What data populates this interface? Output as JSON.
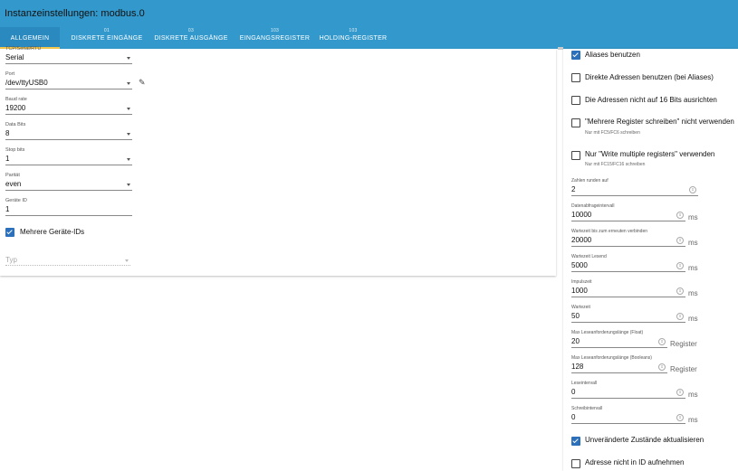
{
  "window": {
    "title": "Instanzeinstellungen: modbus.0"
  },
  "tabs": [
    {
      "label": "ALLGEMEIN",
      "count": ""
    },
    {
      "label": "DISKRETE EINGÄNGE",
      "count": "01"
    },
    {
      "label": "DISKRETE AUSGÄNGE",
      "count": "03"
    },
    {
      "label": "EINGANGSREGISTER",
      "count": "103"
    },
    {
      "label": "HOLDING-REGISTER",
      "count": "103"
    }
  ],
  "left": {
    "type": {
      "label": "TCP/Serial/RTU",
      "value": "Serial"
    },
    "port": {
      "label": "Port",
      "value": "/dev/ttyUSB0"
    },
    "baud": {
      "label": "Baud rate",
      "value": "19200"
    },
    "databits": {
      "label": "Data Bits",
      "value": "8"
    },
    "stopbits": {
      "label": "Stop bits",
      "value": "1"
    },
    "parity": {
      "label": "Parität",
      "value": "even"
    },
    "deviceid": {
      "label": "Geräte ID",
      "value": "1"
    },
    "multi_ids": {
      "label": "Mehrere Geräte-IDs",
      "checked": true
    },
    "typ": {
      "placeholder": "Typ"
    }
  },
  "right": {
    "checkboxes": [
      {
        "label": "Aliases benutzen",
        "checked": true,
        "hint": ""
      },
      {
        "label": "Direkte Adressen benutzen (bei Aliases)",
        "checked": false,
        "hint": ""
      },
      {
        "label": "Die Adressen nicht auf 16 Bits ausrichten",
        "checked": false,
        "hint": ""
      },
      {
        "label": "\"Mehrere Register schreiben\" nicht verwenden",
        "checked": false,
        "hint": "Nur mit FC5/FC6 schreiben"
      },
      {
        "label": "Nur \"Write multiple registers\" verwenden",
        "checked": false,
        "hint": "Nur mit FC15/FC16 schreiben"
      }
    ],
    "fields": [
      {
        "label": "Zahlen runden auf",
        "value": "2",
        "unit": ""
      },
      {
        "label": "Datenabfrageintervall",
        "value": "10000",
        "unit": "ms"
      },
      {
        "label": "Wartezeit bis zum erneuten verbinden",
        "value": "20000",
        "unit": "ms"
      },
      {
        "label": "Wartezeit Lesend",
        "value": "5000",
        "unit": "ms"
      },
      {
        "label": "Impulszeit",
        "value": "1000",
        "unit": "ms"
      },
      {
        "label": "Wartezeit",
        "value": "50",
        "unit": "ms"
      },
      {
        "label": "Max Leseanforderungslänge (Float)",
        "value": "20",
        "unit": "Register"
      },
      {
        "label": "Max Leseanforderungslänge (Booleans)",
        "value": "128",
        "unit": "Register"
      },
      {
        "label": "Leseintervall",
        "value": "0",
        "unit": "ms"
      },
      {
        "label": "Schreibintervall",
        "value": "0",
        "unit": "ms"
      }
    ],
    "bottom_checkboxes": [
      {
        "label": "Unveränderte Zustände aktualisieren",
        "checked": true
      },
      {
        "label": "Adresse nicht in ID aufnehmen",
        "checked": false
      }
    ]
  }
}
